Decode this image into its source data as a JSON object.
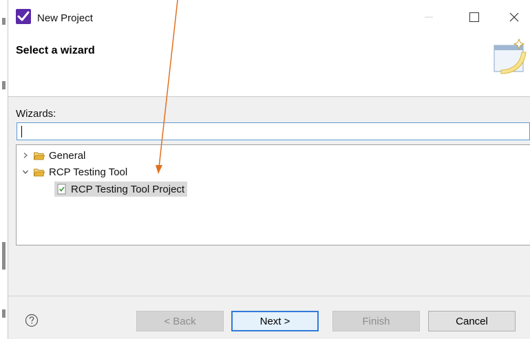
{
  "window": {
    "title": "New Project",
    "controls": {
      "minimize": "minimize-icon",
      "maximize": "maximize-icon",
      "close": "close-icon"
    }
  },
  "header": {
    "title": "Select a wizard",
    "banner_icon": "new-project-wizard-icon"
  },
  "wizards": {
    "label": "Wizards:",
    "filter_value": "",
    "tree": [
      {
        "label": "General",
        "expanded": false,
        "icon": "folder-icon"
      },
      {
        "label": "RCP Testing Tool",
        "expanded": true,
        "icon": "folder-icon",
        "children": [
          {
            "label": "RCP Testing Tool Project",
            "selected": true,
            "icon": "project-icon"
          }
        ]
      }
    ]
  },
  "footer": {
    "help_icon": "help-icon",
    "back_label": "< Back",
    "next_label": "Next >",
    "finish_label": "Finish",
    "cancel_label": "Cancel"
  },
  "colors": {
    "accent": "#2f7ad8",
    "app_icon": "#6a3fbf",
    "folder": "#e8b53a",
    "annotation_arrow": "#e07020"
  }
}
